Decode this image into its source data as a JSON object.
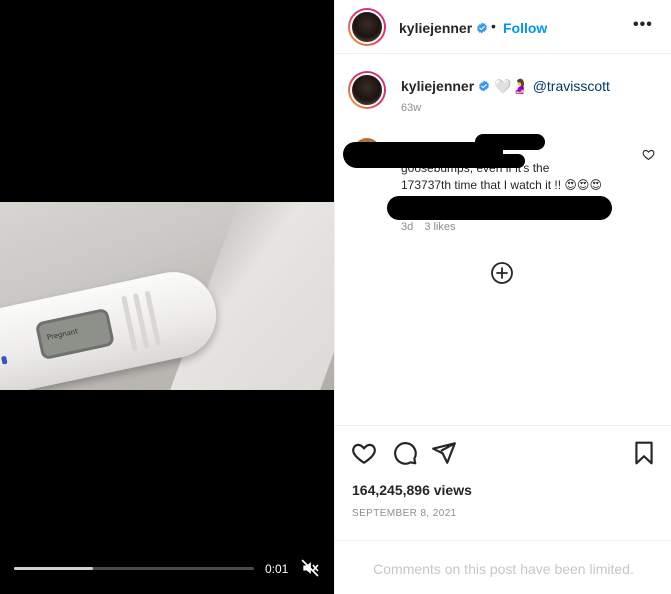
{
  "video": {
    "test_text": "Pregnant",
    "timecode": "0:01",
    "progress_fraction": 0.33,
    "mute_icon": "speaker-muted-icon"
  },
  "header": {
    "username": "kyliejenner",
    "separator": "•",
    "follow_label": "Follow",
    "more_label": "•••"
  },
  "caption": {
    "username": "kyliejenner",
    "emoji_text": "🤍🤰",
    "mention": "@travisscott",
    "age": "63w"
  },
  "comment": {
    "text_line1": "goosebumps, even if it's the",
    "text_line2": "173737th time that I watch it !! 😍😍😍",
    "age": "3d",
    "likes": "3 likes"
  },
  "post": {
    "views": "164,245,896 views",
    "date": "SEPTEMBER 8, 2021",
    "comments_limited": "Comments on this post have been limited."
  },
  "colors": {
    "accent": "#0095f6",
    "verified": "#3897f0",
    "muted_text": "#8e8e8e",
    "video_background": "#000000"
  },
  "icons": [
    "verified-badge-icon",
    "more-icon",
    "heart-icon",
    "comment-icon",
    "share-icon",
    "save-icon",
    "add-circle-icon",
    "speaker-muted-icon"
  ]
}
